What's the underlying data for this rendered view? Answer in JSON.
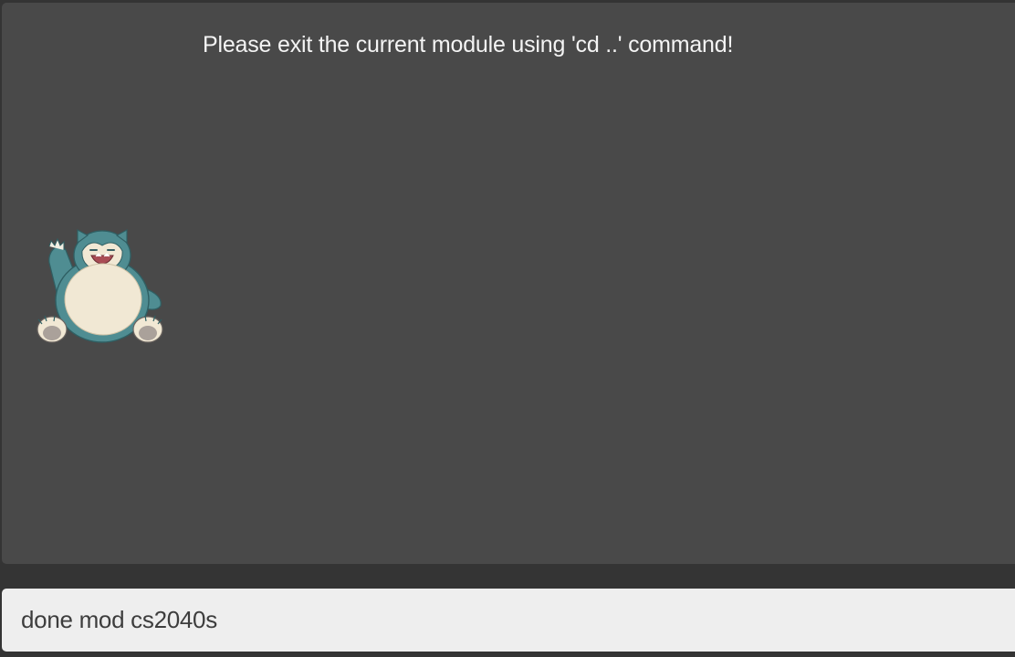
{
  "result": {
    "message": "Please exit the current module using 'cd ..' command!"
  },
  "mascot": {
    "icon": "snorlax-mascot-icon",
    "colors": {
      "body": "#4f8d92",
      "belly": "#f1e8d4",
      "mouth": "#a94c55"
    }
  },
  "command": {
    "value": "done mod cs2040s",
    "placeholder": ""
  },
  "colors": {
    "app_background": "#343434",
    "panel_background": "#494949",
    "text": "#f4f4f4",
    "command_background": "#eeeeee",
    "command_text": "#3d3d3d"
  }
}
